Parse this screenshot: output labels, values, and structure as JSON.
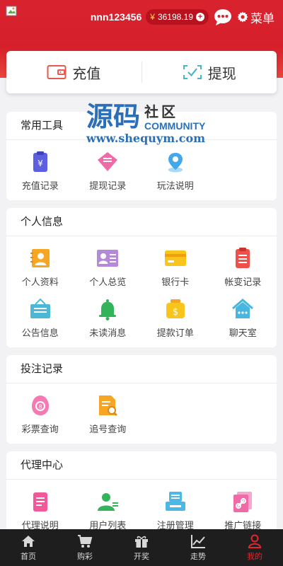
{
  "header": {
    "username": "nnn123456",
    "currency_symbol": "¥",
    "balance": "36198.19",
    "menu_label": "菜单"
  },
  "funds": {
    "recharge_label": "充值",
    "withdraw_label": "提现"
  },
  "watermark": {
    "title": "源码",
    "sub": "社区",
    "community": "COMMUNITY",
    "url": "www.shequym.com"
  },
  "sections": {
    "tools": {
      "title": "常用工具",
      "items": [
        "充值记录",
        "提现记录",
        "玩法说明"
      ]
    },
    "personal": {
      "title": "个人信息",
      "items": [
        "个人资料",
        "个人总览",
        "银行卡",
        "帐变记录",
        "公告信息",
        "未读消息",
        "提款订单",
        "聊天室"
      ]
    },
    "bets": {
      "title": "投注记录",
      "items": [
        "彩票查询",
        "追号查询"
      ]
    },
    "agent": {
      "title": "代理中心",
      "items": [
        "代理说明",
        "用户列表",
        "注册管理",
        "推广链接"
      ]
    }
  },
  "tabbar": {
    "items": [
      "首页",
      "购彩",
      "开奖",
      "走势",
      "我的"
    ],
    "active": "我的"
  },
  "colors": {
    "brand_red": "#d8232e",
    "tab_bg": "#1e1e1e"
  }
}
